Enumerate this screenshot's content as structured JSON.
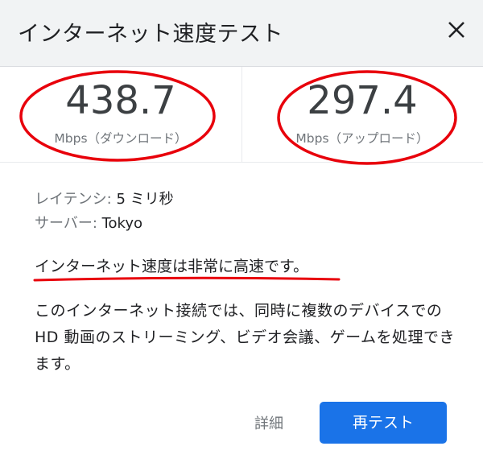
{
  "header": {
    "title": "インターネット速度テスト",
    "close_icon": "close-icon"
  },
  "results": {
    "download": {
      "value": "438.7",
      "unit": "Mbps（ダウンロード）"
    },
    "upload": {
      "value": "297.4",
      "unit": "Mbps（アップロード）"
    }
  },
  "details": {
    "latency_label": "レイテンシ: ",
    "latency_value": "5 ミリ秒",
    "server_label": "サーバー: ",
    "server_value": "Tokyo"
  },
  "verdict": "インターネット速度は非常に高速です。",
  "description": "このインターネット接続では、同時に複数のデバイスでの HD 動画のストリーミング、ビデオ会議、ゲームを処理できます。",
  "actions": {
    "details_label": "詳細",
    "retest_label": "再テスト"
  },
  "colors": {
    "annotation": "#e8000b",
    "primary_button": "#1a73e8",
    "header_bg": "#f1f3f4"
  }
}
